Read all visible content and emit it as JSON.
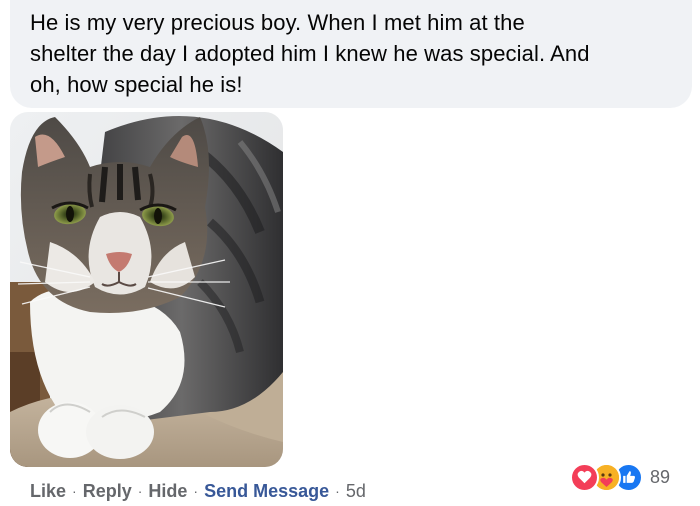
{
  "comment": {
    "text_lines": [
      "He is my very precious boy. When I met him at the",
      "shelter the day I adopted him I knew he was special. And",
      "oh, how special he is!"
    ],
    "photo_alt": "tabby and white cat"
  },
  "actions": {
    "like": "Like",
    "reply": "Reply",
    "hide": "Hide",
    "send_message": "Send Message",
    "separator": "·",
    "timestamp": "5d"
  },
  "reactions": {
    "icons": [
      "love-icon",
      "care-icon",
      "like-icon"
    ],
    "count": "89",
    "colors": {
      "love": "#f33e58",
      "care": "#f7b125",
      "like": "#1877f2"
    }
  }
}
